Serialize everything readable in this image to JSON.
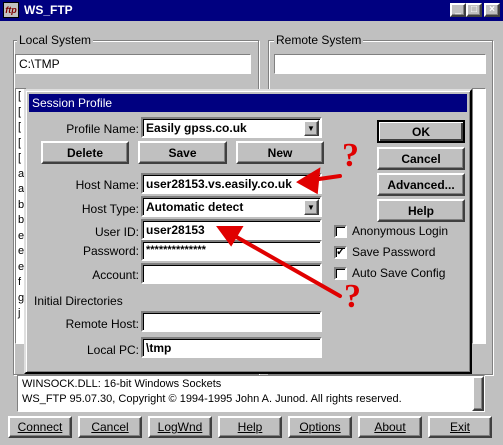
{
  "app": {
    "title": "WS_FTP",
    "icon_text": "ftp",
    "title_buttons": [
      "_",
      "□",
      "×"
    ]
  },
  "local_system": {
    "title": "Local System",
    "path": "C:\\TMP",
    "list_prefixes": [
      "[",
      "[",
      "[",
      "[",
      "[",
      "a",
      "a",
      "b",
      "b",
      "e",
      "e",
      "e",
      "f",
      "g",
      "j"
    ]
  },
  "remote_system": {
    "title": "Remote System",
    "path": ""
  },
  "session_profile": {
    "title": "Session Profile",
    "profile_name_label": "Profile Name:",
    "profile_name_value": "Easily gpss.co.uk",
    "delete_label": "Delete",
    "save_label": "Save",
    "new_label": "New",
    "host_name_label": "Host Name:",
    "host_name_value": "user28153.vs.easily.co.uk",
    "host_type_label": "Host Type:",
    "host_type_value": "Automatic detect",
    "user_id_label": "User ID:",
    "user_id_value": "user28153",
    "password_label": "Password:",
    "password_value": "**************",
    "account_label": "Account:",
    "account_value": "",
    "initial_dirs_label": "Initial Directories",
    "remote_host_label": "Remote Host:",
    "remote_host_value": "",
    "local_pc_label": "Local PC:",
    "local_pc_value": "\\tmp",
    "ok_label": "OK",
    "cancel_label": "Cancel",
    "advanced_label": "Advanced...",
    "help_label": "Help",
    "anonymous_login_label": "Anonymous Login",
    "anonymous_login_checked": false,
    "save_password_label": "Save Password",
    "save_password_checked": true,
    "auto_save_config_label": "Auto Save Config",
    "auto_save_config_checked": false,
    "check_mark": "✓"
  },
  "annotations": {
    "qmark_1": "?",
    "qmark_2": "?",
    "arrow_color": "#e00000"
  },
  "status": {
    "lines": [
      "WINSOCK.DLL: 16-bit Windows Sockets",
      "WS_FTP 95.07.30, Copyright © 1994-1995 John A. Junod. All rights reserved."
    ]
  },
  "bottom_bar": {
    "connect": "Connect",
    "cancel": "Cancel",
    "logwnd": "LogWnd",
    "help": "Help",
    "options": "Options",
    "about": "About",
    "exit": "Exit"
  }
}
